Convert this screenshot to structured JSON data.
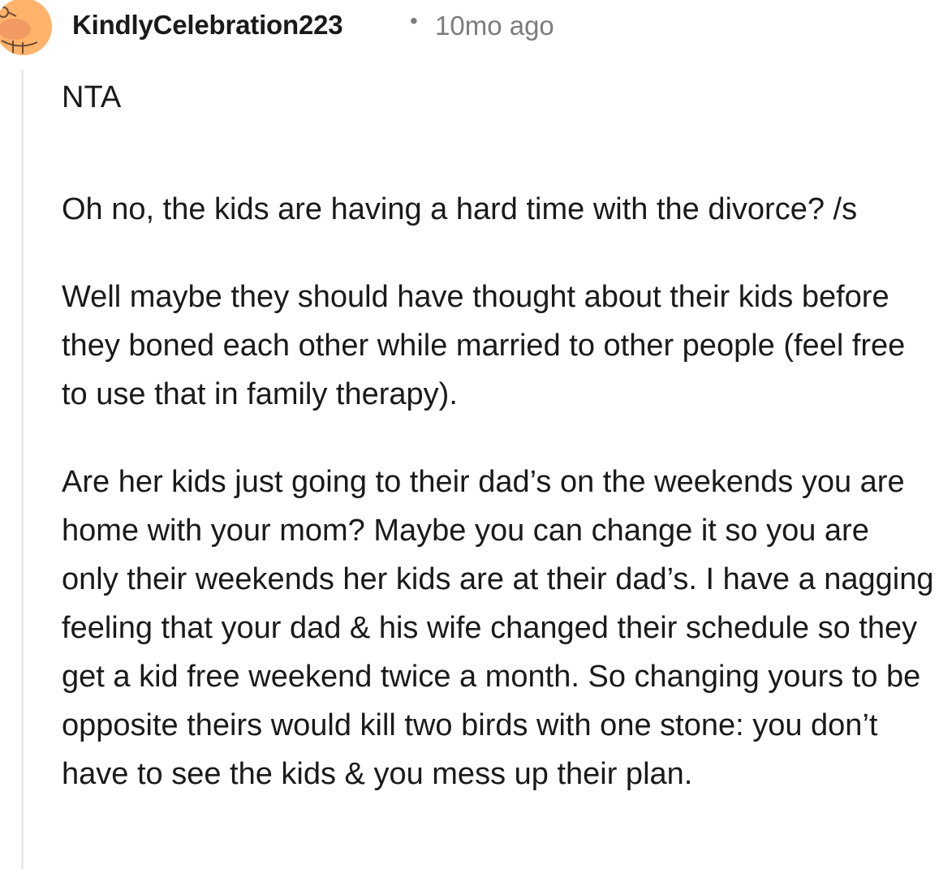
{
  "comment": {
    "username": "KindlyCelebration223",
    "separator": "•",
    "timestamp": "10mo ago",
    "avatar_icon": "snoo-avatar-icon",
    "avatar_color": "#ffb36b",
    "paragraphs": [
      "NTA",
      "Oh no, the kids are having a hard time with the divorce? /s",
      "Well maybe they should have thought about their kids before they boned each other while married to other people (feel free to use that in family therapy).",
      "Are her kids just going to their dad’s on the weekends you are home with your mom? Maybe you can change it so you are only their weekends her kids are at their dad’s. I have a nagging feeling that your dad & his wife changed their schedule so they get a kid free weekend twice a month. So changing yours to be opposite theirs would kill two birds with one stone: you don’t have to see the kids & you mess up their plan."
    ]
  }
}
